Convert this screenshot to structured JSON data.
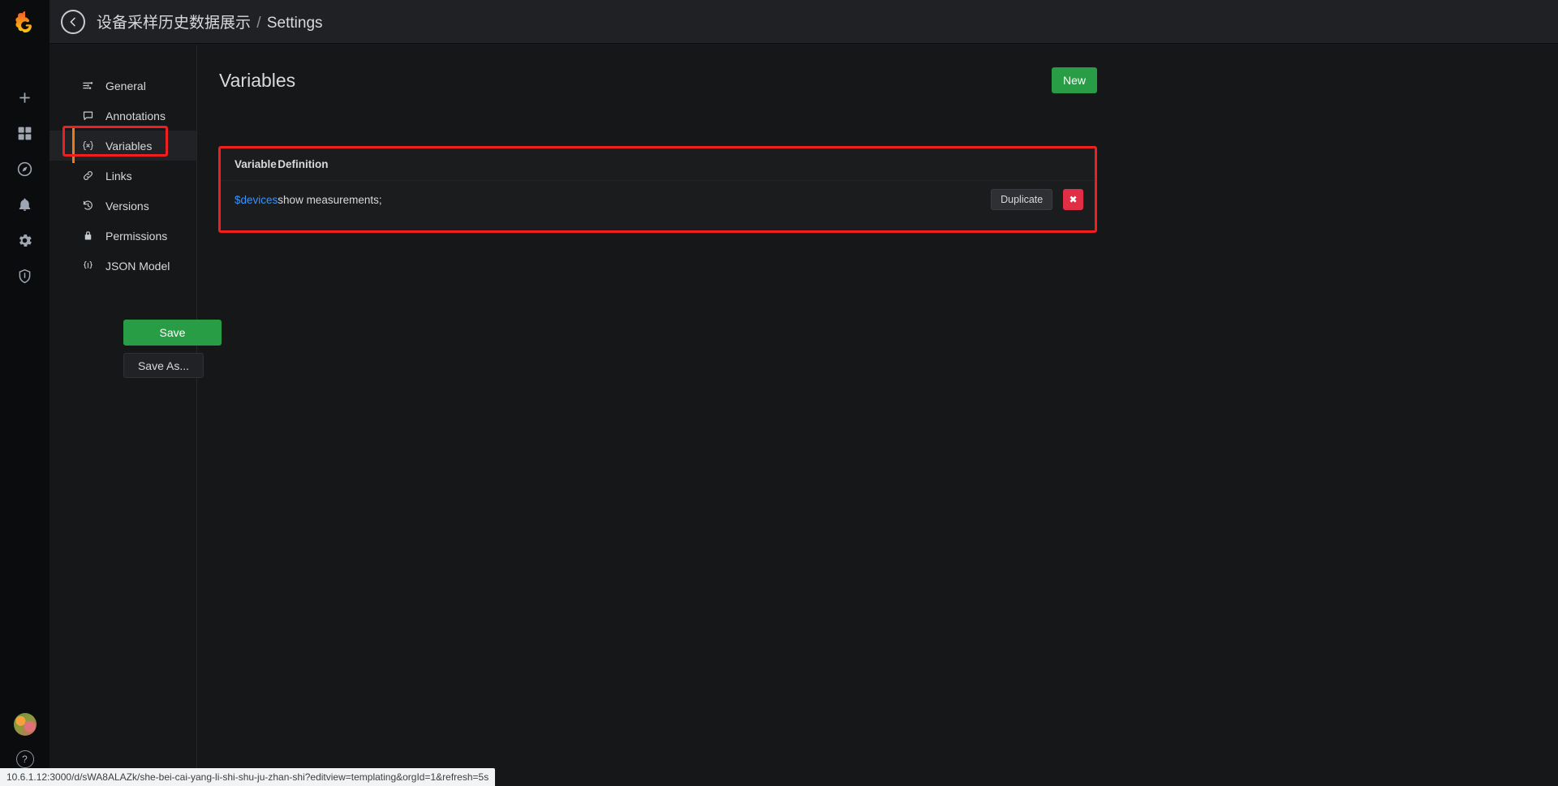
{
  "brand": {
    "logo_icon": "grafana-logo-icon"
  },
  "rail": {
    "items": [
      {
        "icon": "plus-icon",
        "name": "create"
      },
      {
        "icon": "dashboards-icon",
        "name": "dashboards"
      },
      {
        "icon": "compass-icon",
        "name": "explore"
      },
      {
        "icon": "bell-icon",
        "name": "alerting"
      },
      {
        "icon": "gear-icon",
        "name": "configuration"
      },
      {
        "icon": "shield-icon",
        "name": "server-admin"
      }
    ],
    "avatar_icon": "user-avatar",
    "help_label": "?"
  },
  "header": {
    "back_icon": "arrow-left-icon",
    "dashboard_title": "设备采样历史数据展示",
    "separator": "/",
    "section": "Settings"
  },
  "settings_nav": {
    "items": [
      {
        "label": "General",
        "icon": "sliders-icon",
        "active": false
      },
      {
        "label": "Annotations",
        "icon": "comment-icon",
        "active": false
      },
      {
        "label": "Variables",
        "icon": "variable-icon",
        "active": true
      },
      {
        "label": "Links",
        "icon": "link-icon",
        "active": false
      },
      {
        "label": "Versions",
        "icon": "history-icon",
        "active": false
      },
      {
        "label": "Permissions",
        "icon": "lock-icon",
        "active": false
      },
      {
        "label": "JSON Model",
        "icon": "json-braces-icon",
        "active": false
      }
    ],
    "save_label": "Save",
    "save_as_label": "Save As..."
  },
  "main": {
    "page_title": "Variables",
    "new_label": "New",
    "table": {
      "columns": [
        "Variable",
        "Definition"
      ],
      "rows": [
        {
          "variable": "$devices",
          "definition": "show measurements;",
          "duplicate_label": "Duplicate",
          "delete_icon": "close-x-icon"
        }
      ]
    }
  },
  "statusbar": {
    "url": "10.6.1.12:3000/d/sWA8ALAZk/she-bei-cai-yang-li-shi-shu-ju-zhan-shi?editview=templating&orgId=1&refresh=5s"
  },
  "colors": {
    "accent_orange": "#eb7b18",
    "green": "#299c46",
    "link_blue": "#3794ff",
    "danger_red": "#e02f44",
    "annotation_red": "#f01f1f"
  }
}
